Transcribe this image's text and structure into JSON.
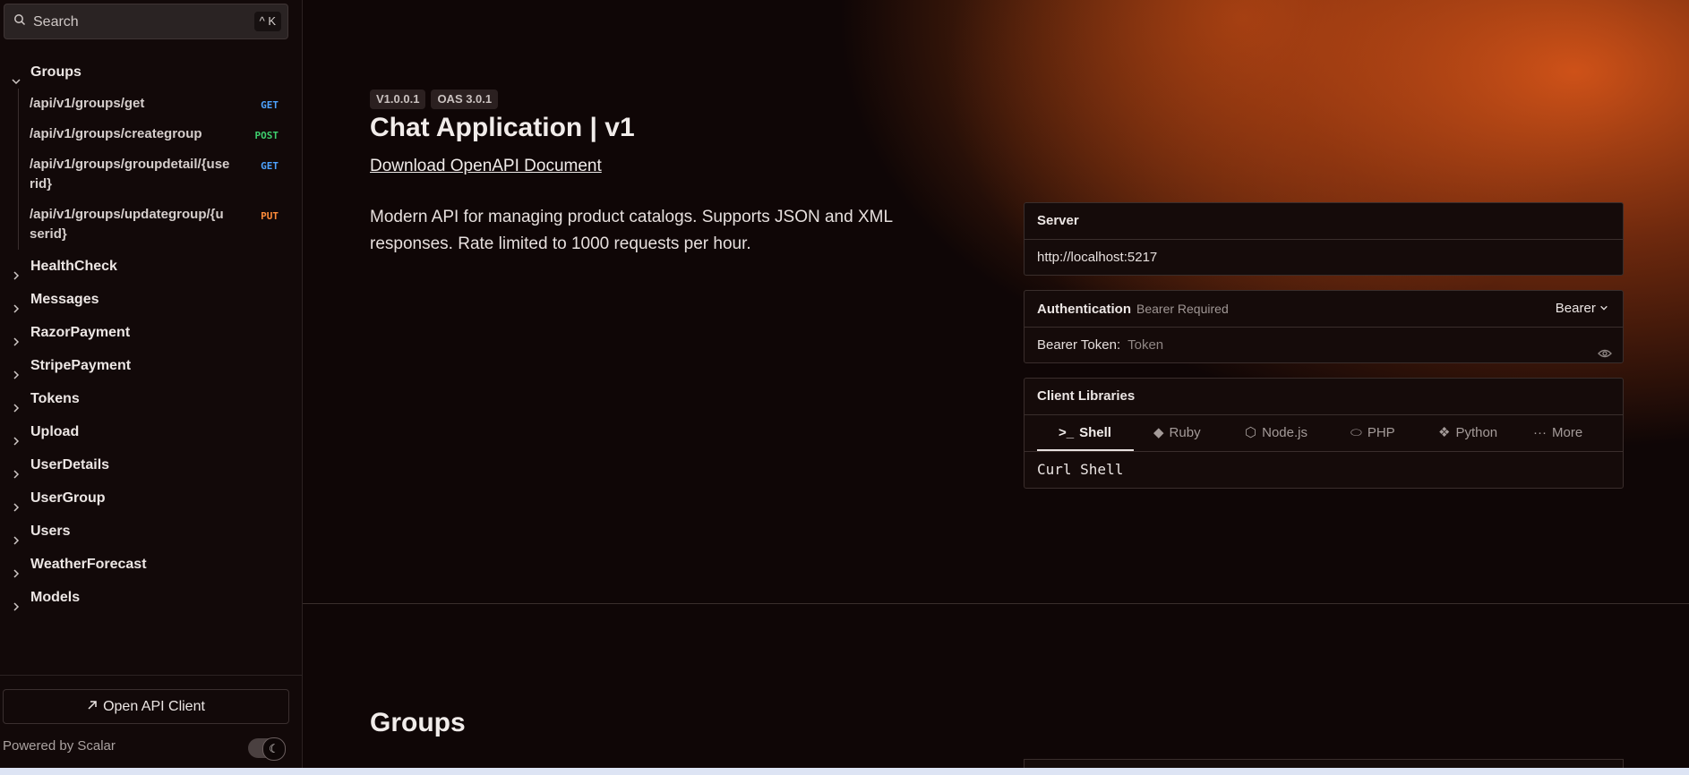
{
  "search": {
    "placeholder": "Search",
    "shortcut": "^ K"
  },
  "sidebar": {
    "open_group": {
      "label": "Groups",
      "items": [
        {
          "path": "/api/v1/groups/get",
          "method": "GET"
        },
        {
          "path": "/api/v1/groups/creategroup",
          "method": "POST"
        },
        {
          "path": "/api/v1/groups/groupdetail/{userid}",
          "method": "GET"
        },
        {
          "path": "/api/v1/groups/updategroup/{userid}",
          "method": "PUT"
        }
      ]
    },
    "groups": [
      "HealthCheck",
      "Messages",
      "RazorPayment",
      "StripePayment",
      "Tokens",
      "Upload",
      "UserDetails",
      "UserGroup",
      "Users",
      "WeatherForecast",
      "Models"
    ],
    "open_client": "Open API Client",
    "powered_by": "Powered by Scalar"
  },
  "main": {
    "version_badge": "V1.0.0.1",
    "oas_badge": "OAS 3.0.1",
    "title": "Chat Application | v1",
    "download_link": "Download OpenAPI Document",
    "description": "Modern API for managing product catalogs. Supports JSON and XML responses. Rate limited to 1000 requests per hour.",
    "section_heading": "Groups"
  },
  "server_card": {
    "label": "Server",
    "url": "http://localhost:5217"
  },
  "auth_card": {
    "label": "Authentication",
    "required": "Bearer Required",
    "scheme": "Bearer",
    "token_label": "Bearer Token:",
    "token_placeholder": "Token"
  },
  "client_libraries": {
    "label": "Client Libraries",
    "tabs": [
      "Shell",
      "Ruby",
      "Node.js",
      "PHP",
      "Python",
      "More"
    ],
    "active_tab": "Shell",
    "code": "Curl Shell"
  },
  "colors": {
    "accent": "#d4581c",
    "background": "#0f0606",
    "get": "#4ea3ff",
    "post": "#3ecf6e",
    "put": "#ff8c3a"
  }
}
